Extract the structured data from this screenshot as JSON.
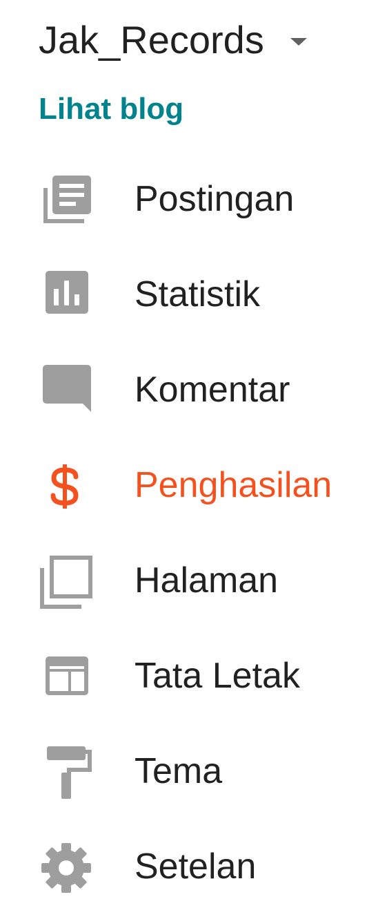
{
  "header": {
    "blog_name": "Jak_Records",
    "view_blog_label": "Lihat blog"
  },
  "colors": {
    "icon_gray": "#9e9e9e",
    "active": "#f4511e",
    "link": "#00838f",
    "text": "#212121"
  },
  "nav": {
    "active_item": "Penghasilan",
    "items": [
      {
        "label": "Postingan",
        "icon": "posts-icon"
      },
      {
        "label": "Statistik",
        "icon": "stats-icon"
      },
      {
        "label": "Komentar",
        "icon": "comment-icon"
      },
      {
        "label": "Penghasilan",
        "icon": "dollar-icon"
      },
      {
        "label": "Halaman",
        "icon": "pages-icon"
      },
      {
        "label": "Tata Letak",
        "icon": "layout-icon"
      },
      {
        "label": "Tema",
        "icon": "paint-roller-icon"
      },
      {
        "label": "Setelan",
        "icon": "gear-icon"
      }
    ]
  }
}
